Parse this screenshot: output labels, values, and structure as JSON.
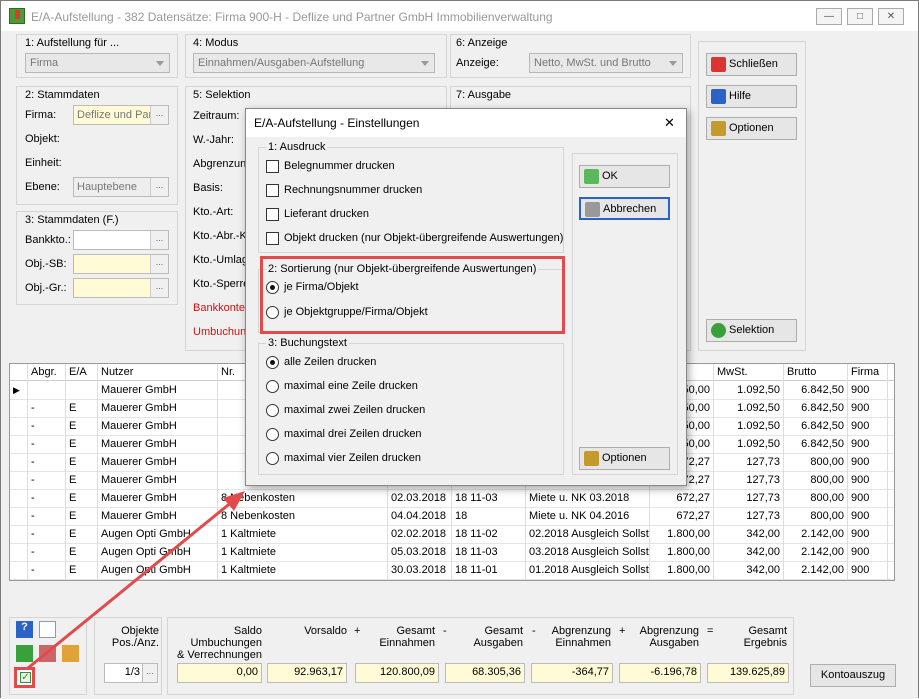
{
  "window": {
    "title": "E/A-Aufstellung - 382 Datensätze:  Firma 900-H - Deflize und Partner GmbH Immobilienverwaltung",
    "min": "—",
    "max": "□",
    "close": "✕"
  },
  "aufstellung": {
    "label": "1: Aufstellung für ...",
    "value": "Firma"
  },
  "modus": {
    "label": "4: Modus",
    "value": "Einnahmen/Ausgaben-Aufstellung"
  },
  "anzeige": {
    "label": "6: Anzeige",
    "field": "Anzeige:",
    "value": "Netto, MwSt. und Brutto"
  },
  "stammdaten": {
    "label": "2: Stammdaten",
    "firma": "Firma:",
    "firma_value": "Deflize und Par",
    "objekt": "Objekt:",
    "einheit": "Einheit:",
    "ebene": "Ebene:",
    "ebene_value": "Hauptebene"
  },
  "selektion": {
    "label": "5: Selektion",
    "items": [
      "Zeitraum:",
      "W.-Jahr:",
      "Abgrenzung",
      "Basis:",
      "Kto.-Art:",
      "Kto.-Abr.-Kr",
      "Kto.-Umlage",
      "Kto.-Sperre:"
    ],
    "red": [
      "Bankkonten",
      "Umbuchung"
    ]
  },
  "ausgabe": {
    "label": "7: Ausgabe"
  },
  "stammdaten_f": {
    "label": "3: Stammdaten (F.)",
    "bankkto": "Bankkto.:",
    "objsb": "Obj.-SB:",
    "objgr": "Obj.-Gr.:"
  },
  "buttons": {
    "schliessen": "Schließen",
    "hilfe": "Hilfe",
    "optionen": "Optionen",
    "selektion": "Selektion",
    "kontoauszug": "Kontoauszug"
  },
  "grid": {
    "headers": [
      "Abgr.",
      "E/A",
      "Nutzer",
      "Nr.",
      "",
      "",
      "",
      "",
      "MwSt.",
      "Brutto",
      "Firma"
    ],
    "rows": [
      [
        "",
        "",
        "Mauerer GmbH",
        "",
        "",
        "",
        "",
        "50,00",
        "1.092,50",
        "6.842,50",
        "900"
      ],
      [
        "-",
        "E",
        "Mauerer GmbH",
        "",
        "",
        "",
        "",
        "50,00",
        "1.092,50",
        "6.842,50",
        "900"
      ],
      [
        "-",
        "E",
        "Mauerer GmbH",
        "",
        "",
        "",
        "",
        "50,00",
        "1.092,50",
        "6.842,50",
        "900"
      ],
      [
        "-",
        "E",
        "Mauerer GmbH",
        "",
        "",
        "",
        "",
        "50,00",
        "1.092,50",
        "6.842,50",
        "900"
      ],
      [
        "-",
        "E",
        "Mauerer GmbH",
        "",
        "",
        "",
        "",
        "72,27",
        "127,73",
        "800,00",
        "900"
      ],
      [
        "-",
        "E",
        "Mauerer GmbH",
        "",
        "",
        "",
        "",
        "72,27",
        "127,73",
        "800,00",
        "900"
      ],
      [
        "-",
        "E",
        "Mauerer GmbH",
        "8 Nebenkosten",
        "02.03.2018",
        "18 11-03",
        "Miete u. NK 03.2018",
        "672,27",
        "127,73",
        "800,00",
        "900"
      ],
      [
        "-",
        "E",
        "Mauerer GmbH",
        "8 Nebenkosten",
        "04.04.2018",
        "18",
        "Miete u. NK 04.2016",
        "672,27",
        "127,73",
        "800,00",
        "900"
      ],
      [
        "-",
        "E",
        "Augen Opti GmbH",
        "1 Kaltmiete",
        "02.02.2018",
        "18 11-02",
        "02.2018 Ausgleich Sollst",
        "1.800,00",
        "342,00",
        "2.142,00",
        "900"
      ],
      [
        "-",
        "E",
        "Augen Opti GmbH",
        "1 Kaltmiete",
        "05.03.2018",
        "18 11-03",
        "03.2018 Ausgleich Sollst",
        "1.800,00",
        "342,00",
        "2.142,00",
        "900"
      ],
      [
        "-",
        "E",
        "Augen Opti GmbH",
        "1 Kaltmiete",
        "30.03.2018",
        "18 11-01",
        "01.2018 Ausgleich Sollst",
        "1.800,00",
        "342,00",
        "2.142,00",
        "900"
      ]
    ]
  },
  "footer": {
    "objekte": "Objekte",
    "pos": "Pos./Anz.",
    "pos_value": "1/3",
    "saldo": "Saldo",
    "umb": "Umbuchungen",
    "verr": "& Verrechnungen",
    "saldo_value": "0,00",
    "vorsaldo": "Vorsaldo",
    "vorsaldo_value": "92.963,17",
    "gesamt_ein": "Gesamt",
    "ein": "Einnahmen",
    "ein_value": "120.800,09",
    "gesamt_aus": "Gesamt",
    "aus": "Ausgaben",
    "aus_value": "68.305,36",
    "abgr_ein": "Abgrenzung",
    "abgr_ein2": "Einnahmen",
    "abgr_ein_value": "-364,77",
    "abgr_aus": "Abgrenzung",
    "abgr_aus2": "Ausgaben",
    "abgr_aus_value": "-6.196,78",
    "gesamt": "Gesamt",
    "ergebnis": "Ergebnis",
    "ergebnis_value": "139.625,89",
    "plus": "+",
    "minus": "-",
    "eq": "="
  },
  "dialog": {
    "title": "E/A-Aufstellung - Einstellungen",
    "close": "✕",
    "ausdruck": "1: Ausdruck",
    "checks": [
      "Belegnummer drucken",
      "Rechnungsnummer drucken",
      "Lieferant drucken",
      "Objekt drucken (nur Objekt-übergreifende Auswertungen)"
    ],
    "sortierung": "2: Sortierung (nur Objekt-übergreifende Auswertungen)",
    "sort_opts": [
      "je Firma/Objekt",
      "je Objektgruppe/Firma/Objekt"
    ],
    "buchungstext": "3: Buchungstext",
    "text_opts": [
      "alle Zeilen drucken",
      "maximal eine Zeile drucken",
      "maximal zwei Zeilen drucken",
      "maximal drei Zeilen drucken",
      "maximal vier Zeilen drucken"
    ],
    "ok": "OK",
    "abbrechen": "Abbrechen",
    "optionen": "Optionen"
  }
}
